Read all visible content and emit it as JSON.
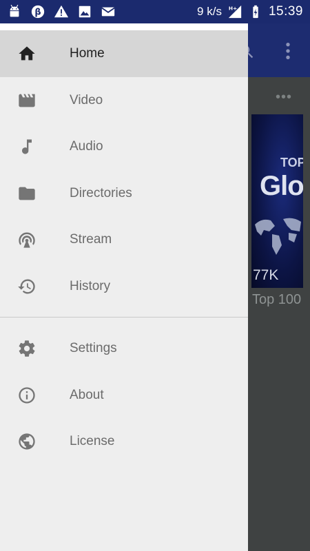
{
  "status_bar": {
    "left_icons": [
      "android-icon",
      "data-saver-icon",
      "warning-icon",
      "image-icon",
      "mail-icon"
    ],
    "speed": "9 k/s",
    "network": "H+",
    "time": "15:39"
  },
  "background": {
    "thumb_text_top": "TOP",
    "thumb_text_main": "Glo",
    "thumb_views": "77K",
    "caption": "Top 100"
  },
  "drawer": {
    "primary": [
      {
        "label": "Home",
        "icon": "home-icon",
        "active": true
      },
      {
        "label": "Video",
        "icon": "video-icon",
        "active": false
      },
      {
        "label": "Audio",
        "icon": "music-note-icon",
        "active": false
      },
      {
        "label": "Directories",
        "icon": "folder-icon",
        "active": false
      },
      {
        "label": "Stream",
        "icon": "stream-icon",
        "active": false
      },
      {
        "label": "History",
        "icon": "history-icon",
        "active": false
      }
    ],
    "secondary": [
      {
        "label": "Settings",
        "icon": "gear-icon"
      },
      {
        "label": "About",
        "icon": "info-icon"
      },
      {
        "label": "License",
        "icon": "globe-icon"
      }
    ]
  },
  "colors": {
    "status_bar": "#1b2a6e",
    "toolbar": "#1d2c70",
    "drawer_bg": "#eeeeee",
    "active_item_bg": "#d6d6d6"
  }
}
